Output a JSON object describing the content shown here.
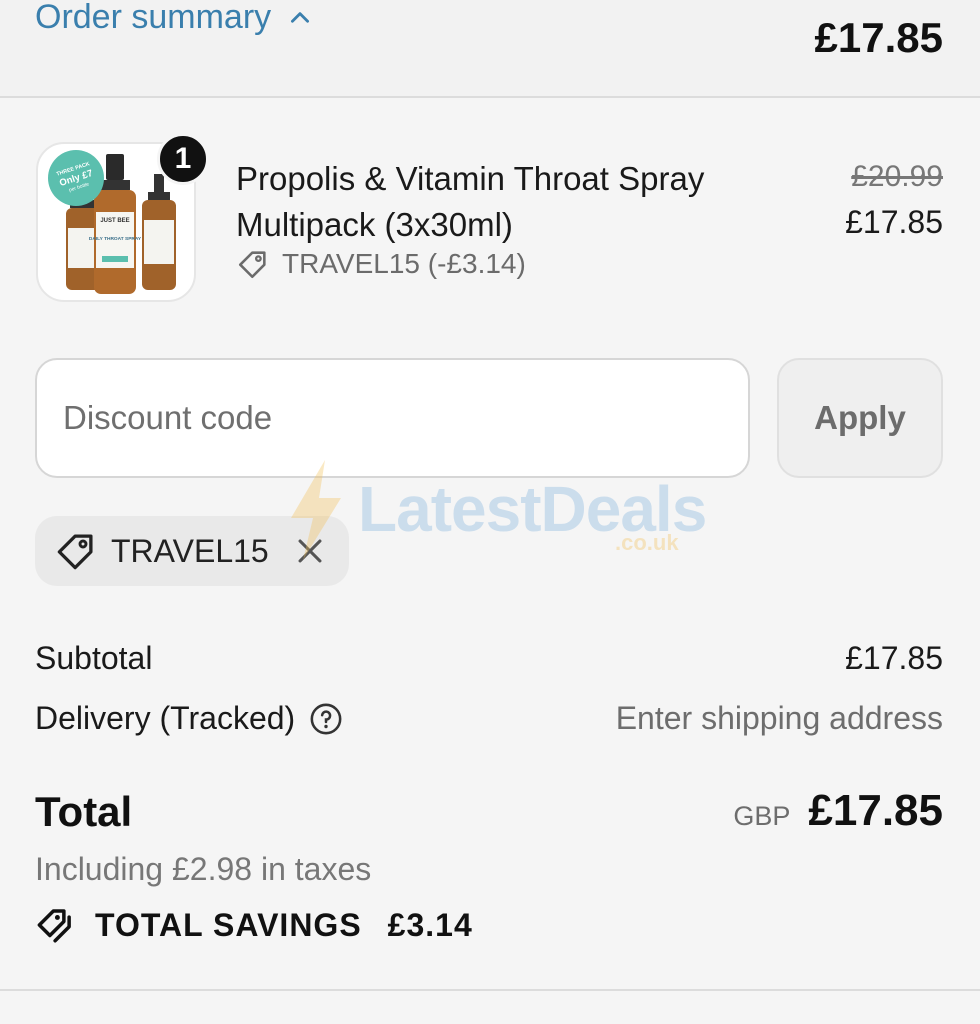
{
  "header": {
    "summary_label": "Order summary",
    "total": "£17.85",
    "icons": {
      "toggle": "chevron-up-icon"
    }
  },
  "product": {
    "quantity": "1",
    "name_line1": "Propolis & Vitamin Throat Spray",
    "name_line2": "Multipack (3x30ml)",
    "discount_applied": "TRAVEL15 (-£3.14)",
    "original_price": "£20.99",
    "price": "£17.85",
    "image_labels": {
      "badge": "THREE PACK",
      "badge_price": "Only £7",
      "badge_unit": "per bottle",
      "brand": "JUST BEE",
      "product": "DAILY THROAT SPRAY"
    }
  },
  "discount": {
    "placeholder": "Discount code",
    "apply_label": "Apply",
    "applied_code": "TRAVEL15"
  },
  "watermark": {
    "text": "LatestDeals",
    "sub": ".co.uk"
  },
  "totals": {
    "subtotal_label": "Subtotal",
    "subtotal_value": "£17.85",
    "delivery_label": "Delivery (Tracked)",
    "delivery_value": "Enter shipping address",
    "total_label": "Total",
    "currency": "GBP",
    "total_value": "£17.85",
    "taxes": "Including £2.98 in taxes",
    "savings_label": "TOTAL SAVINGS",
    "savings_value": "£3.14"
  },
  "colors": {
    "link": "#3a7fad",
    "badge_teal": "#5bbfae",
    "amber": "#b8722a"
  }
}
